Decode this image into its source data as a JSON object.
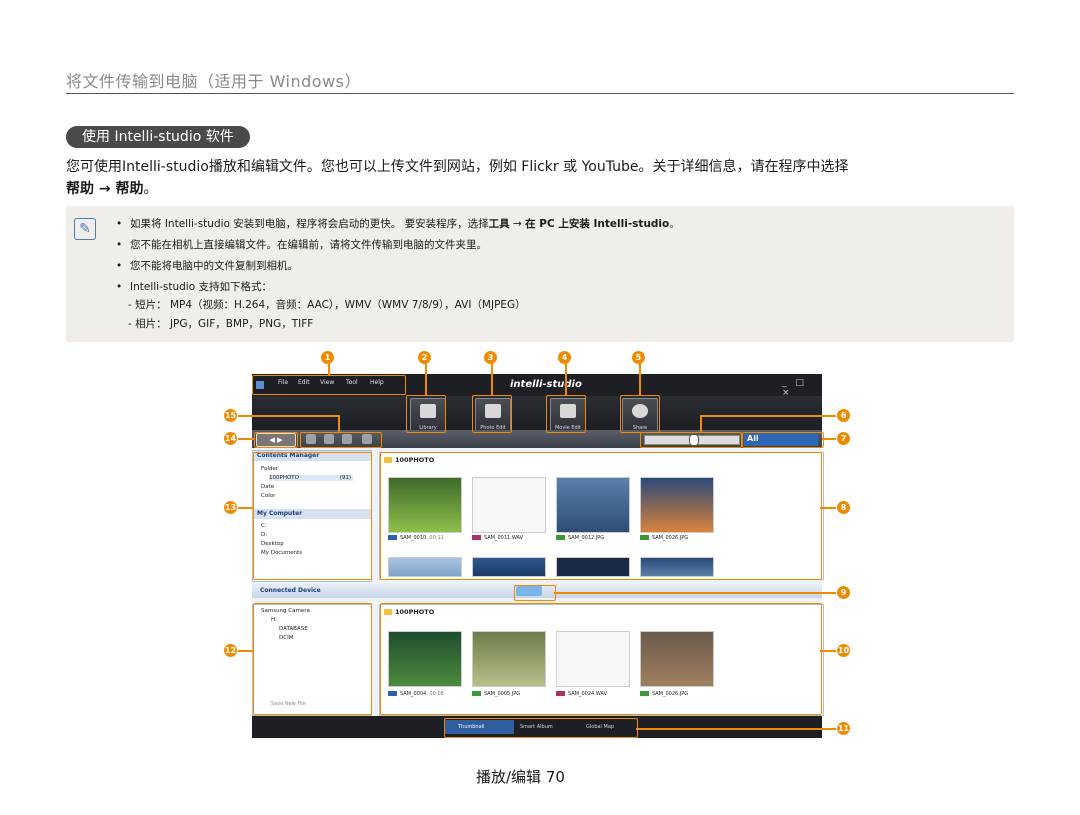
{
  "header": {
    "title": "将文件传输到电脑（适用于 Windows）"
  },
  "section": {
    "pill": "使用 Intelli-studio 软件"
  },
  "intro": {
    "line1": "您可使用Intelli-studio播放和编辑文件。您也可以上传文件到网站，例如 Flickr 或 YouTube。关于详细信息，请在程序中选择",
    "line2": "帮助 → 帮助",
    "line2_end": "。"
  },
  "note": {
    "icon": "note-pencil-icon",
    "items": [
      {
        "pre": "如果将 Intelli-studio 安装到电脑，程序将会启动的更快。 要安装程序，选择",
        "bold1": "工具",
        "mid": " → ",
        "bold2": "在 PC 上安装 Intelli-studio",
        "post": "。"
      },
      {
        "text": "您不能在相机上直接编辑文件。在编辑前，请将文件传输到电脑的文件夹里。"
      },
      {
        "text": "您不能将电脑中的文件复制到相机。"
      },
      {
        "text": "Intelli-studio 支持如下格式："
      }
    ],
    "sub_items": [
      "- 短片： MP4（视频：H.264，音频：AAC），WMV（WMV 7/8/9），AVI（MJPEG）",
      "- 相片： JPG，GIF，BMP，PNG，TIFF"
    ]
  },
  "app": {
    "menu": [
      "File",
      "Edit",
      "View",
      "Tool",
      "Help"
    ],
    "brand": "intelli-studio",
    "window_controls": "_ □ ×",
    "tools": [
      "Library",
      "Photo Edit",
      "Movie Edit",
      "Share"
    ],
    "nav_arrows": "◀ ▶",
    "filter_label": "All",
    "contents_manager": "Contents Manager",
    "tree_top": [
      "Folder",
      "100PHOTO",
      "(91)",
      "Date",
      "Color"
    ],
    "my_computer": "My Computer",
    "tree_computer": [
      "C:",
      "D:",
      "Desktop",
      "My Documents"
    ],
    "folder_top": "100PHOTO",
    "top_captions": [
      "SAM_0010.",
      "00:11",
      "SAM_0011.WAV",
      "SAM_0012.JPG",
      "SAM_0026.JPG"
    ],
    "connected_device": "Connected Device",
    "tree_device": [
      "Samsung Camera",
      "H:",
      "DATABASE",
      "DCIM"
    ],
    "save_new_file": "Save New File",
    "folder_bottom": "100PHOTO",
    "bottom_captions": [
      "SAM_0004.",
      "00:08",
      "SAM_0005.JPG",
      "SAM_0024.WAV",
      "SAM_0026.JPG"
    ],
    "view_modes": [
      "Thumbnail",
      "Smart Album",
      "Global Map"
    ]
  },
  "callouts": [
    "1",
    "2",
    "3",
    "4",
    "5",
    "6",
    "7",
    "8",
    "9",
    "10",
    "11",
    "12",
    "13",
    "14",
    "15"
  ],
  "footer": {
    "text": "播放/编辑 70"
  },
  "colors": {
    "callout": "#f08a00",
    "accent": "#2d66b5"
  }
}
